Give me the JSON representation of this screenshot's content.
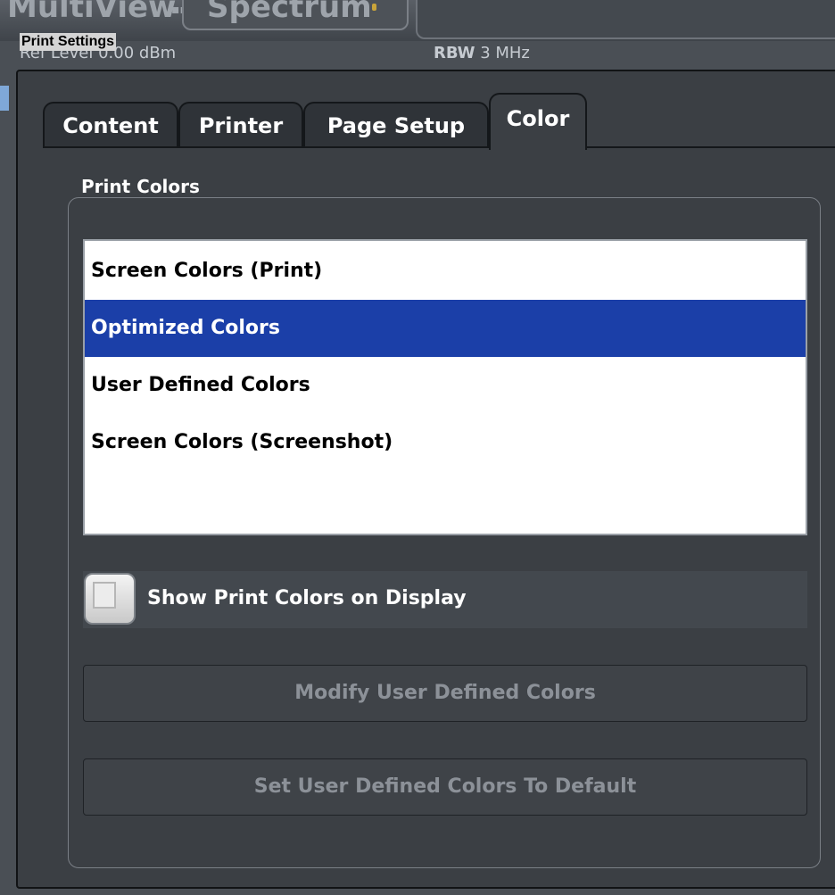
{
  "background": {
    "tab_multiview": "MultiView",
    "tab_multiview_icon": "grid-icon",
    "tab_spectrum": "Spectrum",
    "ref_level_label": "Ref Level",
    "ref_level_value": "0.00 dBm",
    "rbw_label": "RBW",
    "rbw_value": "3 MHz"
  },
  "dialog": {
    "title": "Print Settings",
    "tabs": [
      {
        "label": "Content",
        "active": false
      },
      {
        "label": "Printer",
        "active": false
      },
      {
        "label": "Page Setup",
        "active": false
      },
      {
        "label": "Color",
        "active": true
      }
    ],
    "print_colors": {
      "group_label": "Print Colors",
      "options": [
        {
          "label": "Screen Colors (Print)",
          "selected": false
        },
        {
          "label": "Optimized Colors",
          "selected": true
        },
        {
          "label": "User Defined Colors",
          "selected": false
        },
        {
          "label": "Screen Colors (Screenshot)",
          "selected": false
        }
      ],
      "show_on_display": {
        "label": "Show Print Colors on Display",
        "checked": false
      },
      "modify_button": {
        "label": "Modify User Defined Colors",
        "enabled": false
      },
      "default_button": {
        "label": "Set User Defined Colors To Default",
        "enabled": false
      }
    }
  },
  "colors": {
    "dialog_bg": "#3b3f44",
    "selection": "#1b3fa8",
    "disabled_text": "#8c9198"
  }
}
